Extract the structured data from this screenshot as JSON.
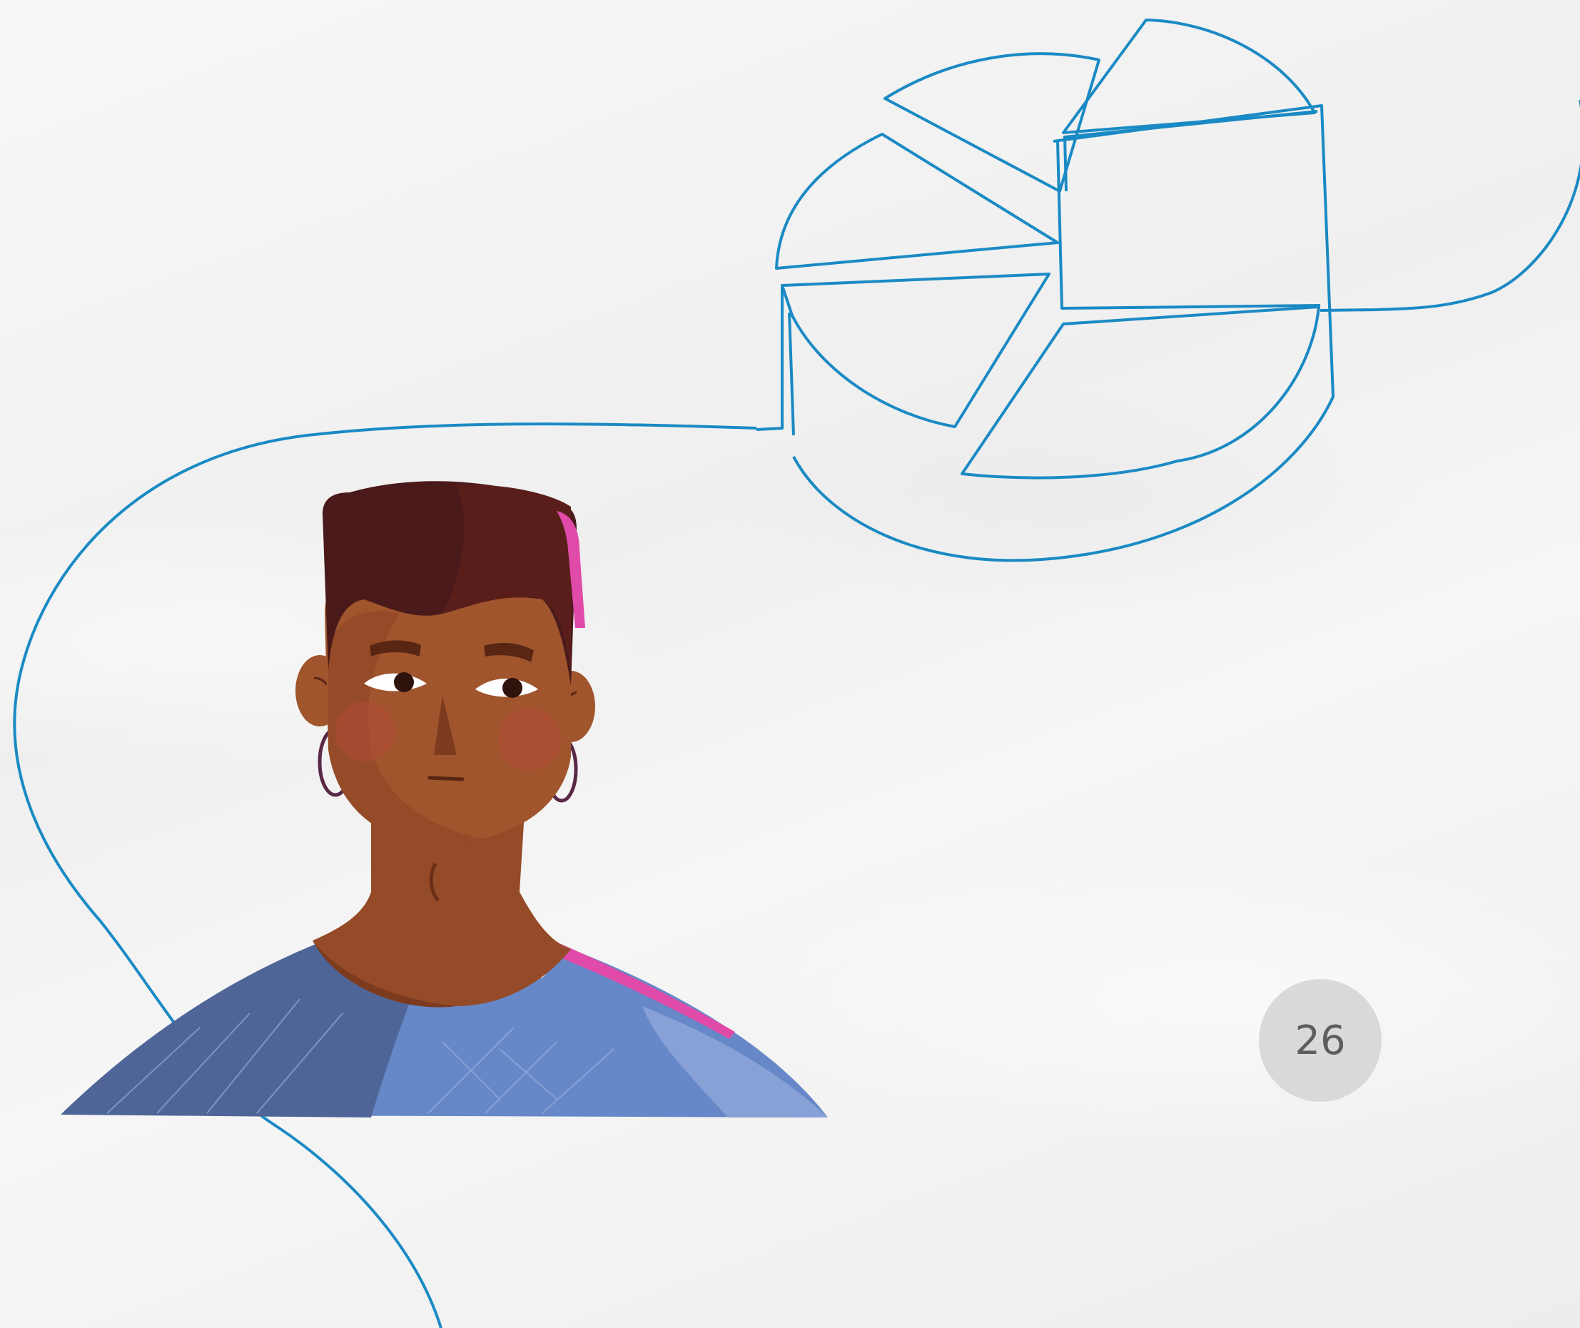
{
  "page": {
    "number": "26"
  },
  "colors": {
    "background": "#f3f3f3",
    "line": "#1a8ac4",
    "badge": "#d8d9da",
    "badge_text": "#5d5e60",
    "hair": "#4a1a1a",
    "skin": "#a0552d",
    "shirt": "#6688c8",
    "accent": "#e04aa8"
  },
  "icons": [
    "exploded-pie-chart-icon",
    "person-illustration"
  ]
}
